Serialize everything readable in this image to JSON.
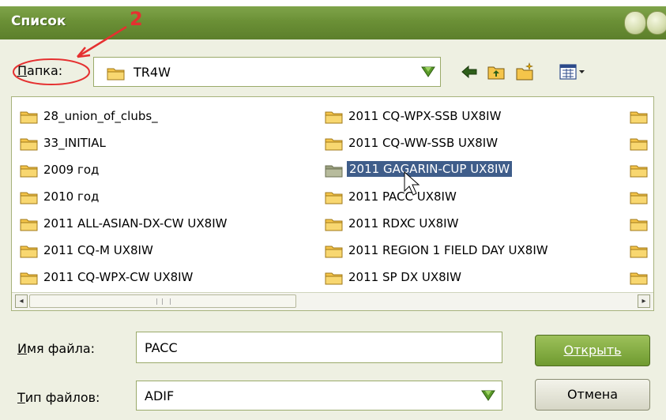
{
  "window": {
    "title": "Список"
  },
  "annotation": {
    "number": "2"
  },
  "folder_bar": {
    "label": "Папка:",
    "label_accel": "П",
    "label_rest": "апка:",
    "value": "TR4W",
    "icons": [
      "back-arrow-icon",
      "folder-up-icon",
      "new-folder-icon",
      "view-menu-icon"
    ]
  },
  "file_list": {
    "column1": [
      "28_union_of_clubs_",
      "33_INITIAL",
      "2009 год",
      "2010 год",
      "2011 ALL-ASIAN-DX-CW UX8IW",
      "2011 CQ-M UX8IW",
      "2011 CQ-WPX-CW UX8IW"
    ],
    "column2": [
      "2011 CQ-WPX-SSB UX8IW",
      "2011 CQ-WW-SSB UX8IW",
      "2011 GAGARIN-CUP UX8IW",
      "2011 PACC UX8IW",
      "2011 RDXC UX8IW",
      "2011 REGION 1 FIELD DAY UX8IW",
      "2011 SP DX UX8IW"
    ],
    "selected": "2011 GAGARIN-CUP UX8IW"
  },
  "file_name": {
    "label_accel": "И",
    "label_rest": "мя файла:",
    "value": "PACC"
  },
  "file_type": {
    "label_accel": "Т",
    "label_rest": "ип файлов:",
    "value": "ADIF"
  },
  "buttons": {
    "open": "Открыть",
    "cancel": "Отмена"
  },
  "colors": {
    "titlebar": "#6b9036",
    "selection": "#3f5d8a",
    "annotation": "#e53030",
    "folder": "#f5c54a"
  }
}
